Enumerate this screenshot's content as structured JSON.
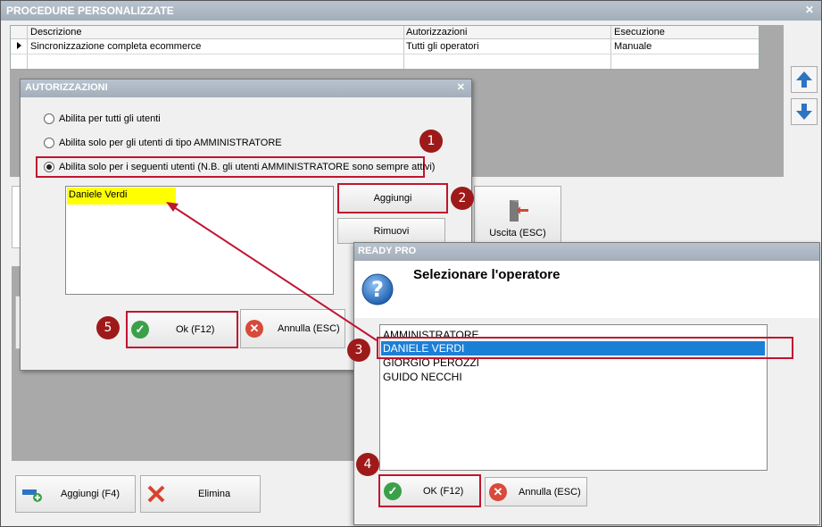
{
  "main": {
    "title": "PROCEDURE PERSONALIZZATE",
    "grid": {
      "columns": [
        "Descrizione",
        "Autorizzazioni",
        "Esecuzione"
      ],
      "rows": [
        [
          "Sincronizzazione completa ecommerce",
          "Tutti gli operatori",
          "Manuale"
        ]
      ]
    },
    "exit_label": "Uscita (ESC)",
    "add_label": "Aggiungi (F4)",
    "delete_label": "Elimina"
  },
  "auth_dialog": {
    "title": "AUTORIZZAZIONI",
    "options": [
      "Abilita per tutti gli utenti",
      "Abilita solo per gli utenti di tipo AMMINISTRATORE",
      "Abilita solo per i seguenti utenti (N.B. gli utenti AMMINISTRATORE sono sempre attivi)"
    ],
    "selected_option": 2,
    "users": [
      "Daniele Verdi"
    ],
    "add_label": "Aggiungi",
    "remove_label": "Rimuovi",
    "ok_label": "Ok (F12)",
    "cancel_label": "Annulla (ESC)"
  },
  "op_dialog": {
    "title": "READY PRO",
    "prompt": "Selezionare l'operatore",
    "operators": [
      "AMMINISTRATORE",
      "DANIELE VERDI",
      "GIORGIO PEROZZI",
      "GUIDO NECCHI"
    ],
    "selected_index": 1,
    "ok_label": "OK (F12)",
    "cancel_label": "Annulla (ESC)"
  },
  "steps": [
    "1",
    "2",
    "3",
    "4",
    "5"
  ],
  "colors": {
    "highlight": "#c0152f",
    "badge": "#9e1a1a",
    "selection": "#1c7fd6",
    "user_highlight": "#ffff00",
    "ok_green": "#3aa04a",
    "cancel_red": "#d84a3a"
  }
}
